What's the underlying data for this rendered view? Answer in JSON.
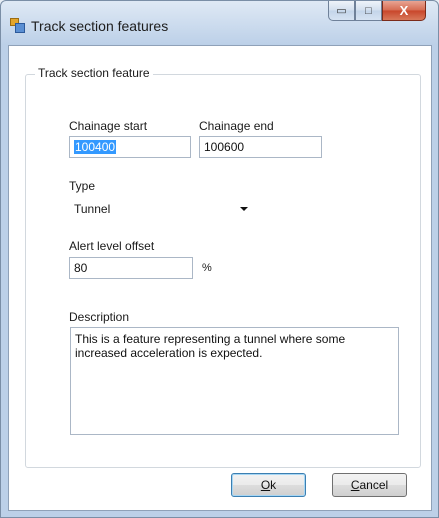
{
  "window": {
    "title": "Track section features",
    "minimize_glyph": "▭",
    "maximize_glyph": "□",
    "close_glyph": "X"
  },
  "group": {
    "legend": "Track section feature"
  },
  "chainage_start": {
    "label": "Chainage start",
    "value": "100400"
  },
  "chainage_end": {
    "label": "Chainage end",
    "value": "100600"
  },
  "type": {
    "label": "Type",
    "selected": "Tunnel"
  },
  "alert_level_offset": {
    "label": "Alert level offset",
    "value": "80",
    "unit": "%"
  },
  "description": {
    "label": "Description",
    "value": "This is a feature representing a tunnel where some increased acceleration is expected."
  },
  "buttons": {
    "ok_underlined": "O",
    "ok_rest": "k",
    "cancel_underlined": "C",
    "cancel_rest": "ancel"
  },
  "icons": {
    "app": "app-window-icon",
    "dropdown": "chevron-down-icon"
  }
}
